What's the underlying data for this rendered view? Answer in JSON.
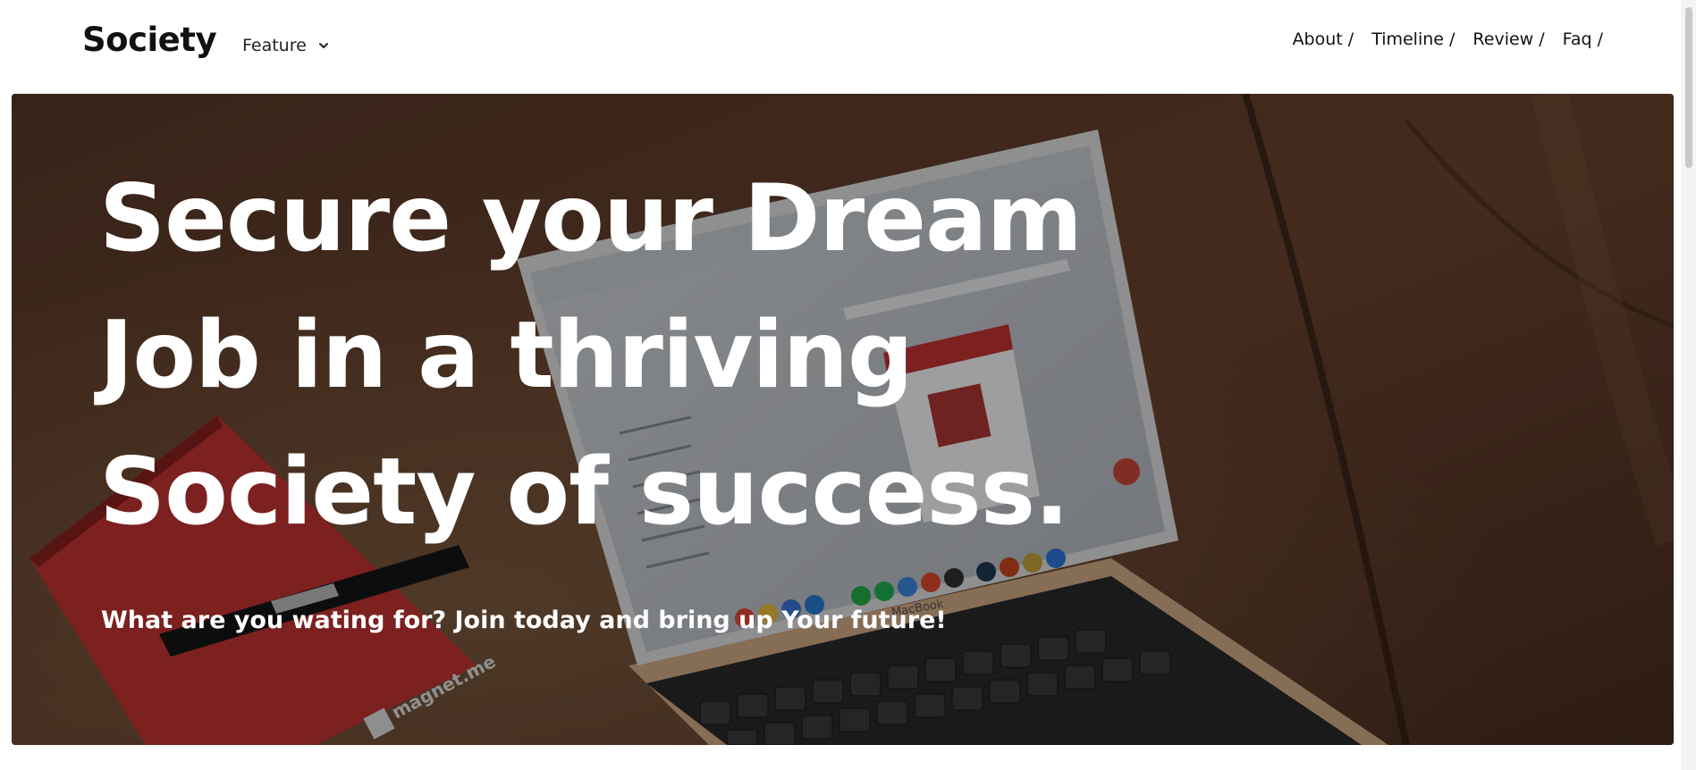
{
  "navbar": {
    "brand": "Society",
    "feature_label": "Feature",
    "links": [
      "About /",
      "Timeline /",
      "Review /",
      "Faq /"
    ]
  },
  "hero": {
    "title_lines": [
      "Secure your Dream",
      "Job in a thriving",
      "Society of success."
    ],
    "subtitle": "What are you wating for? Join today and bring up Your future!",
    "notebook_text": "magnet.me",
    "laptop_brand": "MacBook"
  },
  "colors": {
    "text_dark": "#111111",
    "hero_text": "#ffffff",
    "notebook_red": "#c93434"
  }
}
